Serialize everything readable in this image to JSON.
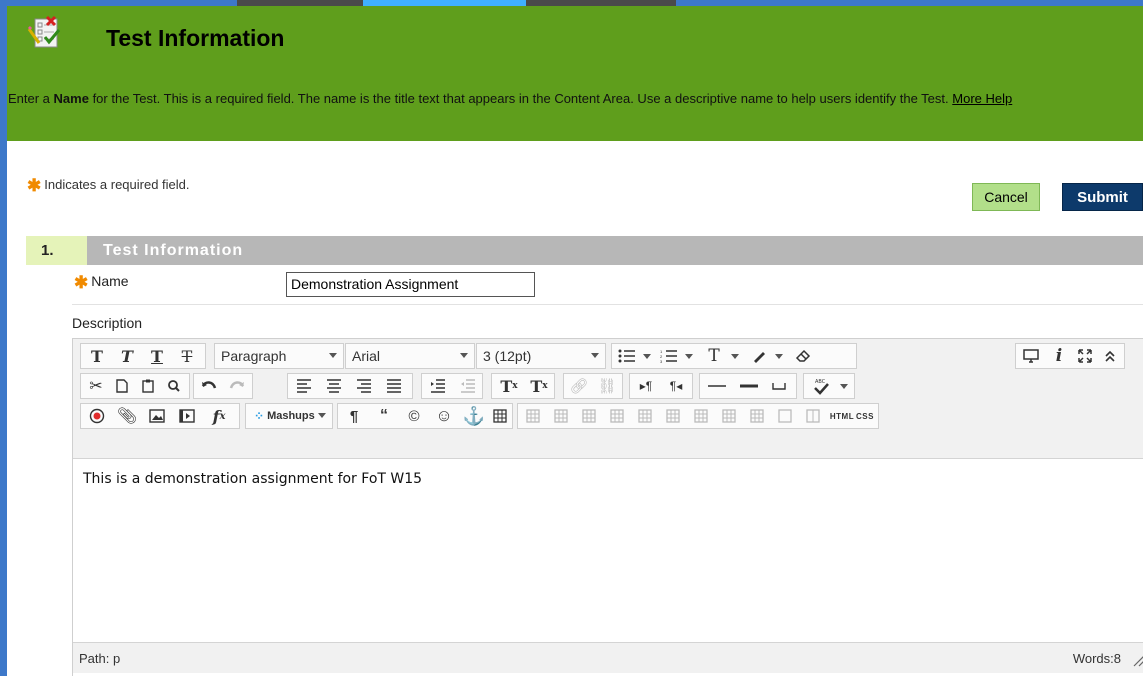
{
  "colors": {
    "banner": "#5f9e1c",
    "submit": "#0d3a6b",
    "cancel": "#b2df8a",
    "star": "#f08a00",
    "step_bg": "#e5f3b9",
    "section_bar": "#b7b7b7"
  },
  "header": {
    "title": "Test Information",
    "help_bold": "Name",
    "help_pre": "Enter a ",
    "help_post": " for the Test. This is a required field. The name is the title text that appears in the Content Area. Use a descriptive name to help users identify the Test.",
    "more_help": "More Help",
    "icon": "test-checklist-icon"
  },
  "required_note": "Indicates a required field.",
  "buttons": {
    "cancel": "Cancel",
    "submit": "Submit"
  },
  "section": {
    "number": "1.",
    "title": "Test Information"
  },
  "form": {
    "name_label": "Name",
    "name_value": "Demonstration Assignment",
    "description_label": "Description"
  },
  "editor": {
    "format_block": "Paragraph",
    "font_family": "Arial",
    "font_size": "3 (12pt)",
    "mashups_label": "Mashups",
    "html_label": "HTML",
    "css_label": "CSS",
    "content": "This is a demonstration assignment for FoT W15",
    "path": "Path: p",
    "words": "Words:8"
  }
}
